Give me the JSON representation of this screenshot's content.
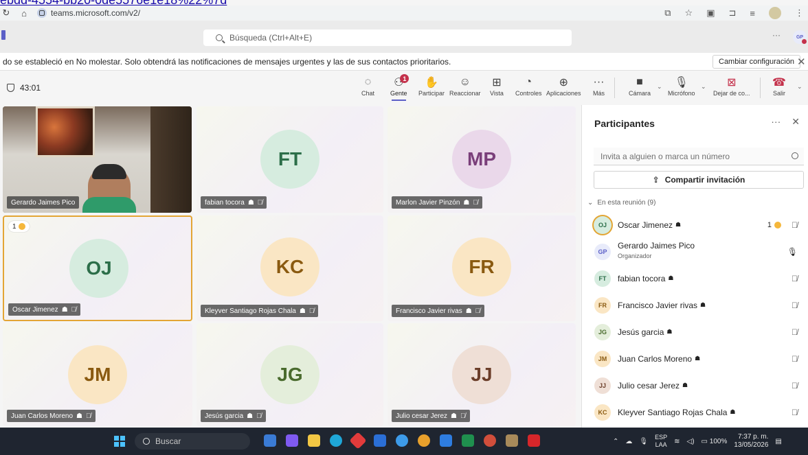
{
  "browser": {
    "top_link": "ebdd-4554-bb20-0de5576e1e18%22%7d",
    "url": "teams.microsoft.com/v2/"
  },
  "header": {
    "search_placeholder": "Búsqueda (Ctrl+Alt+E)",
    "more": "···",
    "user_initials": "GP"
  },
  "notification": {
    "text": "do se estableció en No molestar. Solo obtendrá las notificaciones de mensajes urgentes y las de sus contactos prioritarios.",
    "button": "Cambiar configuración",
    "close": "✕"
  },
  "meeting": {
    "timer": "43:01",
    "people_badge": "1",
    "tools": {
      "chat": "Chat",
      "people": "Gente",
      "raise": "Participar",
      "react": "Reaccionar",
      "view": "Vista",
      "controls": "Controles",
      "apps": "Aplicaciones",
      "more": "Más",
      "camera": "Cámara",
      "mic": "Micrófono",
      "share": "Dejar de co...",
      "leave": "Salir"
    }
  },
  "tiles": [
    {
      "name": "Gerardo Jaimes Pico"
    },
    {
      "initials": "FT",
      "name": "fabian tocora"
    },
    {
      "initials": "MP",
      "name": "Marlon Javier Pinzón"
    },
    {
      "initials": "OJ",
      "name": "Oscar Jimenez",
      "hand": "1"
    },
    {
      "initials": "KC",
      "name": "Kleyver Santiago Rojas Chala"
    },
    {
      "initials": "FR",
      "name": "Francisco Javier rivas"
    },
    {
      "initials": "JM",
      "name": "Juan Carlos Moreno"
    },
    {
      "initials": "JG",
      "name": "Jesús garcia"
    },
    {
      "initials": "JJ",
      "name": "Julio cesar Jerez"
    }
  ],
  "panel": {
    "title": "Participantes",
    "more": "···",
    "close": "✕",
    "search_placeholder": "Invita a alguien o marca un número",
    "share_button": "Compartir invitación",
    "section": "En esta reunión (9)",
    "participants": [
      {
        "initials": "OJ",
        "name": "Oscar Jimenez",
        "hand": "1"
      },
      {
        "initials": "GP",
        "name": "Gerardo Jaimes Pico",
        "role": "Organizador"
      },
      {
        "initials": "FT",
        "name": "fabian tocora"
      },
      {
        "initials": "FR",
        "name": "Francisco Javier rivas"
      },
      {
        "initials": "JG",
        "name": "Jesús garcia"
      },
      {
        "initials": "JM",
        "name": "Juan Carlos Moreno"
      },
      {
        "initials": "JJ",
        "name": "Julio cesar Jerez"
      },
      {
        "initials": "KC",
        "name": "Kleyver Santiago Rojas Chala"
      }
    ]
  },
  "taskbar": {
    "search": "Buscar",
    "lang1": "ESP",
    "lang2": "LAA",
    "battery": "100%",
    "time": "7:37 p. m.",
    "date": "13/05/2026"
  },
  "colors": {
    "teams_purple": "#5b5fc7",
    "speaking_border": "#e3a534",
    "leave_red": "#c4314b"
  }
}
